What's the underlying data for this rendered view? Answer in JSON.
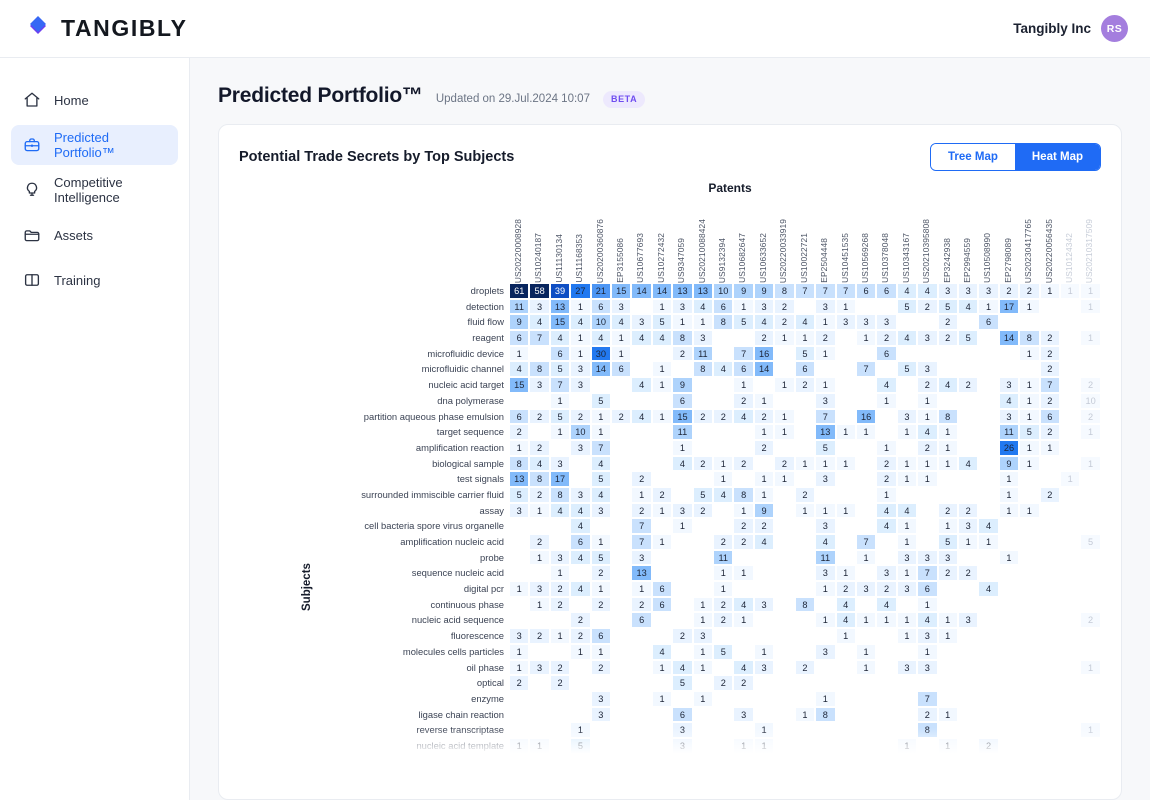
{
  "topbar": {
    "brand_name": "TANGIBLY",
    "brand_icon": "diamond-logo",
    "org_name": "Tangibly Inc",
    "avatar_initials": "RS",
    "avatar_color": "#a47ede"
  },
  "sidebar": {
    "items": [
      {
        "label": "Home",
        "icon": "home-icon",
        "active": false
      },
      {
        "label": "Predicted Portfolio™",
        "icon": "briefcase-icon",
        "active": true
      },
      {
        "label": "Competitive Intelligence",
        "icon": "lightbulb-icon",
        "active": false
      },
      {
        "label": "Assets",
        "icon": "folder-icon",
        "active": false
      },
      {
        "label": "Training",
        "icon": "book-icon",
        "active": false
      }
    ]
  },
  "page": {
    "title": "Predicted Portfolio™",
    "updated": "Updated on 29.Jul.2024 10:07",
    "badge": "BETA",
    "badge_color": "#6f4df0"
  },
  "card": {
    "title": "Potential Trade Secrets by Top Subjects",
    "view_toggle": {
      "options": [
        "Tree Map",
        "Heat Map"
      ],
      "selected": "Heat Map",
      "accent_color": "#1f6bf5"
    }
  },
  "chart_data": {
    "type": "heatmap",
    "title": "Potential Trade Secrets by Top Subjects",
    "xlabel": "Patents",
    "ylabel": "Subjects",
    "colorscale": [
      "#ffffff",
      "#eaf2fe",
      "#d4e5fd",
      "#b7d4fb",
      "#8fbcf8",
      "#4d96f4",
      "#1f6bf5",
      "#0c3f9e",
      "#08255e"
    ],
    "value_range": [
      1,
      61
    ],
    "grid": true,
    "legend": "none",
    "categories": [
      "US20220008928",
      "US10240187",
      "US11130134",
      "US11168353",
      "US20200360876",
      "EP3155086",
      "US10677693",
      "US10272432",
      "US9347059",
      "US20210088424",
      "US9132394",
      "US10682647",
      "US10633652",
      "US20220033919",
      "US10022721",
      "EP2504448",
      "US10451535",
      "US10569268",
      "US10378048",
      "US10343167",
      "US20210395808",
      "EP3242938",
      "EP2994559",
      "US10508990",
      "EP2798089",
      "US20230417765",
      "US20220056435",
      "US10124342",
      "US20210317509"
    ],
    "faded_categories": [
      "US10124342",
      "US20210317509"
    ],
    "rows": [
      "droplets",
      "detection",
      "fluid flow",
      "reagent",
      "microfluidic device",
      "microfluidic channel",
      "nucleic acid target",
      "dna polymerase",
      "partition aqueous phase emulsion",
      "target sequence",
      "amplification reaction",
      "biological sample",
      "test signals",
      "surrounded immiscible carrier fluid",
      "assay",
      "cell bacteria spore virus organelle",
      "amplification nucleic acid",
      "probe",
      "sequence nucleic acid",
      "digital pcr",
      "continuous phase",
      "nucleic acid sequence",
      "fluorescence",
      "molecules cells particles",
      "oil phase",
      "optical",
      "enzyme",
      "ligase chain reaction",
      "reverse transcriptase",
      "nucleic acid template"
    ],
    "values": [
      [
        61,
        58,
        39,
        27,
        21,
        15,
        14,
        14,
        13,
        13,
        10,
        9,
        9,
        8,
        7,
        7,
        7,
        6,
        6,
        4,
        4,
        3,
        3,
        3,
        2,
        2,
        1,
        1,
        1
      ],
      [
        11,
        3,
        13,
        1,
        6,
        3,
        null,
        1,
        3,
        4,
        6,
        1,
        3,
        2,
        null,
        3,
        1,
        null,
        null,
        5,
        2,
        5,
        4,
        1,
        17,
        1,
        null,
        null,
        1
      ],
      [
        9,
        4,
        15,
        4,
        10,
        4,
        3,
        5,
        1,
        1,
        8,
        5,
        4,
        2,
        4,
        1,
        3,
        3,
        3,
        null,
        null,
        2,
        null,
        6,
        null,
        null,
        null,
        null,
        null
      ],
      [
        6,
        7,
        4,
        1,
        4,
        1,
        4,
        4,
        8,
        3,
        null,
        null,
        2,
        1,
        1,
        2,
        null,
        1,
        2,
        4,
        3,
        2,
        5,
        null,
        14,
        8,
        2,
        null,
        1
      ],
      [
        1,
        null,
        6,
        1,
        30,
        1,
        null,
        null,
        2,
        11,
        null,
        7,
        16,
        null,
        5,
        1,
        null,
        null,
        6,
        null,
        null,
        null,
        null,
        null,
        null,
        1,
        2,
        null,
        null
      ],
      [
        4,
        8,
        5,
        3,
        14,
        6,
        null,
        1,
        null,
        8,
        4,
        6,
        14,
        null,
        6,
        null,
        null,
        7,
        null,
        5,
        3,
        null,
        null,
        null,
        null,
        null,
        2,
        null,
        null
      ],
      [
        15,
        3,
        7,
        3,
        null,
        null,
        4,
        1,
        9,
        null,
        null,
        1,
        null,
        1,
        2,
        1,
        null,
        null,
        4,
        null,
        2,
        4,
        2,
        null,
        3,
        1,
        7,
        null,
        2
      ],
      [
        null,
        null,
        1,
        null,
        5,
        null,
        null,
        null,
        6,
        null,
        null,
        2,
        1,
        null,
        null,
        3,
        null,
        null,
        1,
        null,
        1,
        null,
        null,
        null,
        4,
        1,
        2,
        null,
        10
      ],
      [
        6,
        2,
        5,
        2,
        1,
        2,
        4,
        1,
        15,
        2,
        2,
        4,
        2,
        1,
        null,
        7,
        null,
        16,
        null,
        3,
        1,
        8,
        null,
        null,
        3,
        1,
        6,
        null,
        2
      ],
      [
        2,
        null,
        1,
        10,
        1,
        null,
        null,
        null,
        11,
        null,
        null,
        null,
        1,
        1,
        null,
        13,
        1,
        1,
        null,
        1,
        4,
        1,
        null,
        null,
        11,
        5,
        2,
        null,
        1
      ],
      [
        1,
        2,
        null,
        3,
        7,
        null,
        null,
        null,
        1,
        null,
        null,
        null,
        2,
        null,
        null,
        5,
        null,
        null,
        1,
        null,
        2,
        1,
        null,
        null,
        26,
        1,
        1,
        null,
        null
      ],
      [
        8,
        4,
        3,
        null,
        4,
        null,
        null,
        null,
        4,
        2,
        1,
        2,
        null,
        2,
        1,
        1,
        1,
        null,
        2,
        1,
        1,
        1,
        4,
        null,
        9,
        1,
        null,
        null,
        1
      ],
      [
        13,
        8,
        17,
        null,
        5,
        null,
        2,
        null,
        null,
        null,
        1,
        null,
        1,
        1,
        null,
        3,
        null,
        null,
        2,
        1,
        1,
        null,
        null,
        null,
        1,
        null,
        null,
        1,
        null
      ],
      [
        5,
        2,
        8,
        3,
        4,
        null,
        1,
        2,
        null,
        5,
        4,
        8,
        1,
        null,
        2,
        null,
        null,
        null,
        1,
        null,
        null,
        null,
        null,
        null,
        1,
        null,
        2,
        null,
        null
      ],
      [
        3,
        1,
        4,
        4,
        3,
        null,
        2,
        1,
        3,
        2,
        null,
        1,
        9,
        null,
        1,
        1,
        1,
        null,
        4,
        4,
        null,
        2,
        2,
        null,
        1,
        1,
        null,
        null,
        null
      ],
      [
        null,
        null,
        null,
        4,
        null,
        null,
        7,
        null,
        1,
        null,
        null,
        2,
        2,
        null,
        null,
        3,
        null,
        null,
        4,
        1,
        null,
        1,
        3,
        4,
        null,
        null,
        null,
        null,
        null
      ],
      [
        null,
        2,
        null,
        6,
        1,
        null,
        7,
        1,
        null,
        null,
        2,
        2,
        4,
        null,
        null,
        4,
        null,
        7,
        null,
        1,
        null,
        5,
        1,
        1,
        null,
        null,
        null,
        null,
        5
      ],
      [
        null,
        1,
        3,
        4,
        5,
        null,
        3,
        null,
        null,
        null,
        11,
        null,
        null,
        null,
        null,
        11,
        null,
        1,
        null,
        3,
        3,
        3,
        null,
        null,
        1,
        null,
        null,
        null,
        null
      ],
      [
        null,
        null,
        1,
        null,
        2,
        null,
        13,
        null,
        null,
        null,
        1,
        1,
        null,
        null,
        null,
        3,
        1,
        null,
        3,
        1,
        7,
        2,
        2,
        null,
        null,
        null,
        null,
        null,
        null
      ],
      [
        1,
        3,
        2,
        4,
        1,
        null,
        1,
        6,
        null,
        null,
        1,
        null,
        null,
        null,
        null,
        1,
        2,
        3,
        2,
        3,
        6,
        null,
        null,
        4,
        null,
        null,
        null,
        null,
        null
      ],
      [
        null,
        1,
        2,
        null,
        2,
        null,
        2,
        6,
        null,
        1,
        2,
        4,
        3,
        null,
        8,
        null,
        4,
        null,
        4,
        null,
        1,
        null,
        null,
        null,
        null,
        null,
        null,
        null,
        null
      ],
      [
        null,
        null,
        null,
        2,
        null,
        null,
        6,
        null,
        null,
        1,
        2,
        1,
        null,
        null,
        null,
        1,
        4,
        1,
        1,
        1,
        4,
        1,
        3,
        null,
        null,
        null,
        null,
        null,
        2
      ],
      [
        3,
        2,
        1,
        2,
        6,
        null,
        null,
        null,
        2,
        3,
        null,
        null,
        null,
        null,
        null,
        null,
        1,
        null,
        null,
        1,
        3,
        1,
        null,
        null,
        null,
        null,
        null,
        null,
        null
      ],
      [
        1,
        null,
        null,
        1,
        1,
        null,
        null,
        4,
        null,
        1,
        5,
        null,
        1,
        null,
        null,
        3,
        null,
        1,
        null,
        null,
        1,
        null,
        null,
        null,
        null,
        null,
        null,
        null,
        null
      ],
      [
        1,
        3,
        2,
        null,
        2,
        null,
        null,
        1,
        4,
        1,
        null,
        4,
        3,
        null,
        2,
        null,
        null,
        1,
        null,
        3,
        3,
        null,
        null,
        null,
        null,
        null,
        null,
        null,
        1
      ],
      [
        2,
        null,
        2,
        null,
        null,
        null,
        null,
        null,
        5,
        null,
        2,
        2,
        null,
        null,
        null,
        null,
        null,
        null,
        null,
        null,
        null,
        null,
        null,
        null,
        null,
        null,
        null,
        null,
        null
      ],
      [
        null,
        null,
        null,
        null,
        3,
        null,
        null,
        1,
        null,
        1,
        null,
        null,
        null,
        null,
        null,
        1,
        null,
        null,
        null,
        null,
        7,
        null,
        null,
        null,
        null,
        null,
        null,
        null,
        null
      ],
      [
        null,
        null,
        null,
        null,
        3,
        null,
        null,
        null,
        6,
        null,
        null,
        3,
        null,
        null,
        1,
        8,
        null,
        null,
        null,
        null,
        2,
        1,
        null,
        null,
        null,
        null,
        null,
        null,
        null
      ],
      [
        null,
        null,
        null,
        1,
        null,
        null,
        null,
        null,
        3,
        null,
        null,
        null,
        1,
        null,
        null,
        null,
        null,
        null,
        null,
        null,
        8,
        null,
        null,
        null,
        null,
        null,
        null,
        null,
        1
      ],
      [
        1,
        1,
        null,
        5,
        null,
        null,
        null,
        null,
        3,
        null,
        null,
        1,
        1,
        null,
        null,
        null,
        null,
        null,
        null,
        1,
        null,
        1,
        null,
        2,
        null,
        null,
        null,
        null,
        null
      ]
    ]
  }
}
